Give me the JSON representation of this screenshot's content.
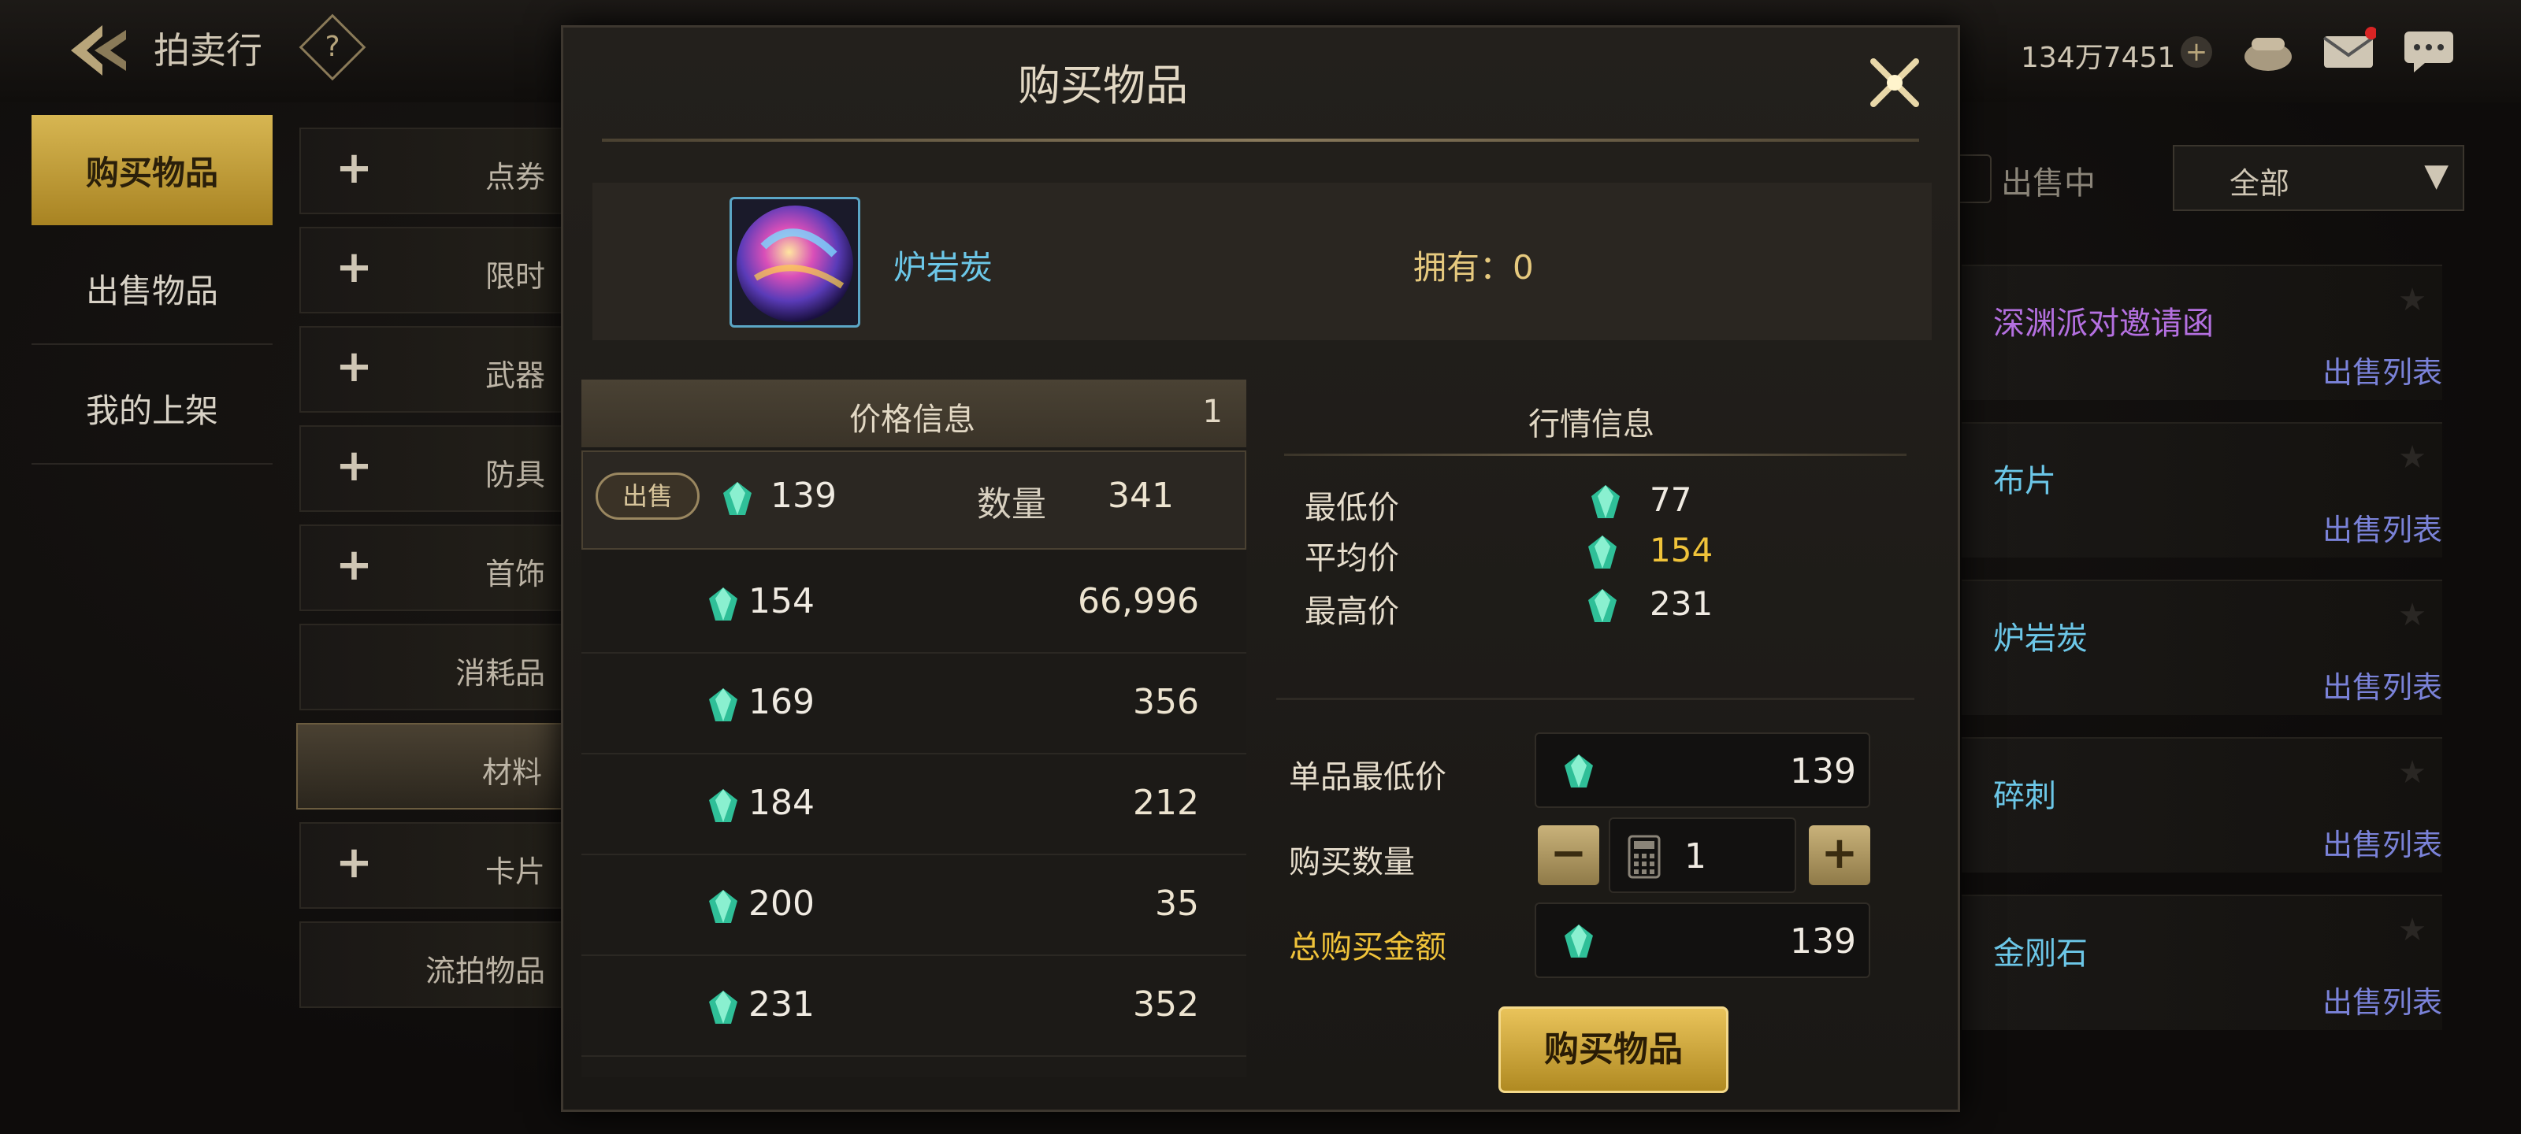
{
  "header": {
    "title": "拍卖行",
    "help_label": "?",
    "currency": "134万7451"
  },
  "left_tabs": [
    {
      "label": "购买物品"
    },
    {
      "label": "出售物品"
    },
    {
      "label": "我的上架"
    }
  ],
  "categories": [
    {
      "label": "点券",
      "expandable": true
    },
    {
      "label": "限时",
      "expandable": true
    },
    {
      "label": "武器",
      "expandable": true
    },
    {
      "label": "防具",
      "expandable": true
    },
    {
      "label": "首饰",
      "expandable": true
    },
    {
      "label": "消耗品",
      "expandable": false
    },
    {
      "label": "材料",
      "expandable": false,
      "selected": true
    },
    {
      "label": "卡片",
      "expandable": true
    },
    {
      "label": "流拍物品",
      "expandable": false
    }
  ],
  "filter": {
    "selling_label": "出售中",
    "dropdown_value": "全部"
  },
  "right_list": [
    {
      "name": "深渊派对邀请函",
      "action": "出售列表",
      "color": "#b470e0"
    },
    {
      "name": "布片",
      "action": "出售列表",
      "color": "#6cc7e8"
    },
    {
      "name": "炉岩炭",
      "action": "出售列表",
      "color": "#6cc7e8"
    },
    {
      "name": "碎刺",
      "action": "出售列表",
      "color": "#6cc7e8"
    },
    {
      "name": "金刚石",
      "action": "出售列表",
      "color": "#6cc7e8"
    }
  ],
  "modal": {
    "title": "购买物品",
    "item_name": "炉岩炭",
    "owned_label": "拥有：",
    "owned_value": "0",
    "price_table": {
      "title": "价格信息",
      "page": "1",
      "sell_label": "出售",
      "qty_label": "数量",
      "rows": [
        {
          "price": "139",
          "qty": "341"
        },
        {
          "price": "154",
          "qty": "66,996"
        },
        {
          "price": "169",
          "qty": "356"
        },
        {
          "price": "184",
          "qty": "212"
        },
        {
          "price": "200",
          "qty": "35"
        },
        {
          "price": "231",
          "qty": "352"
        }
      ]
    },
    "market": {
      "title": "行情信息",
      "min_label": "最低价",
      "min_value": "77",
      "avg_label": "平均价",
      "avg_value": "154",
      "max_label": "最高价",
      "max_value": "231"
    },
    "form": {
      "unit_min_label": "单品最低价",
      "unit_min_value": "139",
      "qty_label": "购买数量",
      "qty_value": "1",
      "total_label": "总购买金额",
      "total_value": "139"
    },
    "buy_button": "购买物品"
  },
  "colors": {
    "gold": "#d7b652",
    "gem": "#3fd0a8",
    "accent_yellow": "#f0c33a",
    "link_blue": "#7a82d8"
  }
}
